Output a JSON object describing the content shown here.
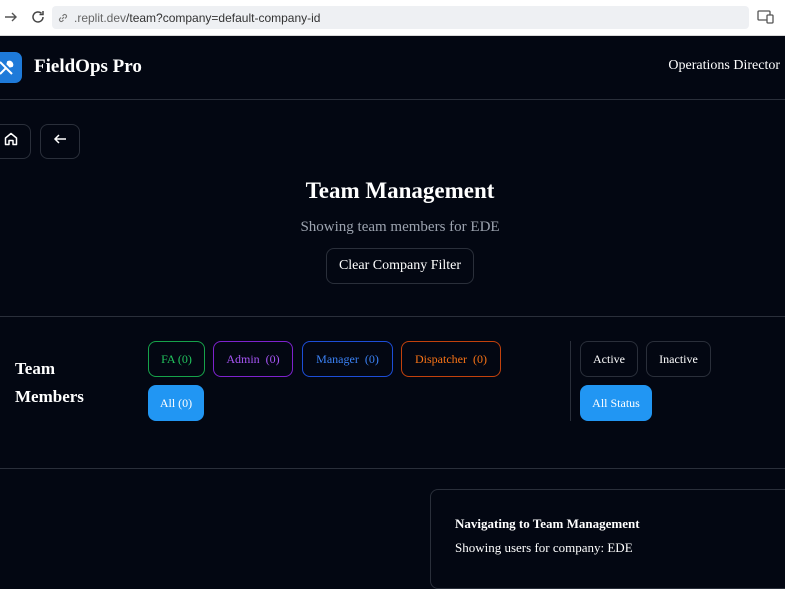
{
  "browser": {
    "url_host": ".replit.dev",
    "url_path": "/team?company=default-company-id"
  },
  "header": {
    "brand": "FieldOps Pro",
    "role": "Operations Director",
    "logo_icon": "wrench-screwdriver-icon"
  },
  "page": {
    "title": "Team Management",
    "subtitle": "Showing team members for EDE",
    "clear_filter_label": "Clear Company Filter"
  },
  "filters": {
    "section_label": "Team Members",
    "roles": [
      {
        "label": "FA (0)",
        "color": "#22c55e"
      },
      {
        "label": "Admin  (0)",
        "color": "#a855f7"
      },
      {
        "label": "Manager  (0)",
        "color": "#3b82f6"
      },
      {
        "label": "Dispatcher  (0)",
        "color": "#f97316"
      },
      {
        "label": "All (0)",
        "color": "#2196f3"
      }
    ],
    "status": [
      {
        "label": "Active"
      },
      {
        "label": "Inactive"
      },
      {
        "label": "All Status",
        "color": "#2196f3"
      }
    ]
  },
  "toast": {
    "title": "Navigating to Team Management",
    "description": "Showing users for company: EDE"
  }
}
